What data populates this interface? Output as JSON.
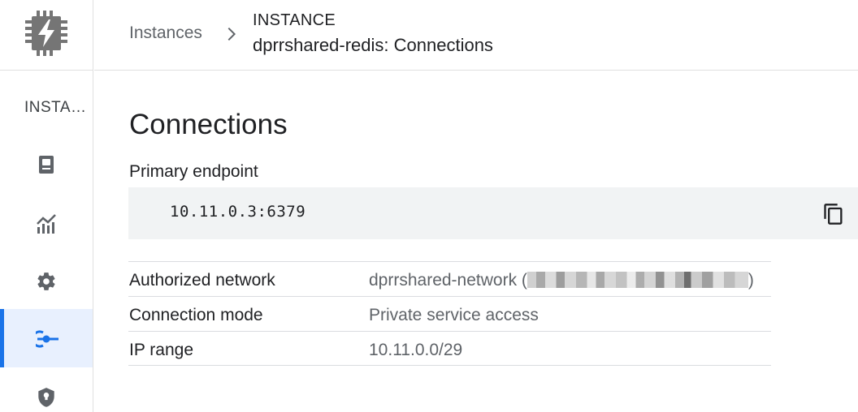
{
  "rail": {
    "logo_icon": "memorystore-chip-icon",
    "section_label": "INSTA…",
    "items": [
      {
        "icon": "instance-details-icon",
        "active": false
      },
      {
        "icon": "monitoring-chart-icon",
        "active": false
      },
      {
        "icon": "gear-icon",
        "active": false
      },
      {
        "icon": "connections-icon",
        "active": true
      },
      {
        "icon": "shield-icon",
        "active": false
      }
    ]
  },
  "header": {
    "breadcrumb_link": "Instances",
    "breadcrumb_separator_icon": "chevron-right-icon",
    "kicker": "INSTANCE",
    "title": "dprrshared-redis: Connections"
  },
  "main": {
    "page_title": "Connections",
    "primary_endpoint": {
      "label": "Primary endpoint",
      "value": "10.11.0.3:6379",
      "copy_icon": "copy-icon"
    },
    "details": [
      {
        "key": "Authorized network",
        "value_prefix": "dprrshared-network (",
        "value_suffix": ")",
        "redacted": true
      },
      {
        "key": "Connection mode",
        "value": "Private service access"
      },
      {
        "key": "IP range",
        "value": "10.11.0.0/29"
      }
    ]
  },
  "colors": {
    "accent": "#1a73e8",
    "active_bg": "#e8f0fe",
    "icon_grey": "#5f6368",
    "endpoint_bg": "#f1f3f4"
  }
}
